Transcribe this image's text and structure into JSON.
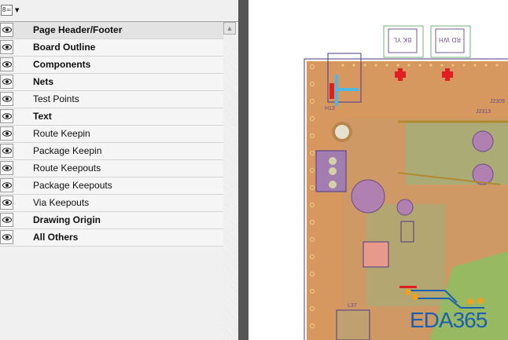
{
  "toolbar": {
    "menu_icon": "list-options-icon"
  },
  "layers": [
    {
      "label": "Page Header/Footer",
      "bold": true,
      "visible": true,
      "selected": true
    },
    {
      "label": "Board Outline",
      "bold": true,
      "visible": true
    },
    {
      "label": "Components",
      "bold": true,
      "visible": true
    },
    {
      "label": "Nets",
      "bold": true,
      "visible": true
    },
    {
      "label": "Test Points",
      "bold": false,
      "visible": true
    },
    {
      "label": "Text",
      "bold": true,
      "visible": true
    },
    {
      "label": "Route Keepin",
      "bold": false,
      "visible": true
    },
    {
      "label": "Package Keepin",
      "bold": false,
      "visible": true
    },
    {
      "label": "Route Keepouts",
      "bold": false,
      "visible": true
    },
    {
      "label": "Package Keepouts",
      "bold": false,
      "visible": true
    },
    {
      "label": "Via Keepouts",
      "bold": false,
      "visible": true
    },
    {
      "label": "Drawing Origin",
      "bold": true,
      "visible": true
    },
    {
      "label": "All Others",
      "bold": true,
      "visible": true
    }
  ],
  "board": {
    "connectors": [
      "BK YL",
      "RD WH"
    ],
    "ref_labels": [
      "H13",
      "J2309",
      "J2313",
      "L37"
    ],
    "watermark": "EDA365",
    "colors": {
      "board": "#d6985e",
      "outline": "#4a3a8a",
      "trace_green": "#7fc08a",
      "pad_red": "#e02020",
      "via_blue": "#4fb8e0",
      "watermark": "#1d5fb0"
    }
  }
}
